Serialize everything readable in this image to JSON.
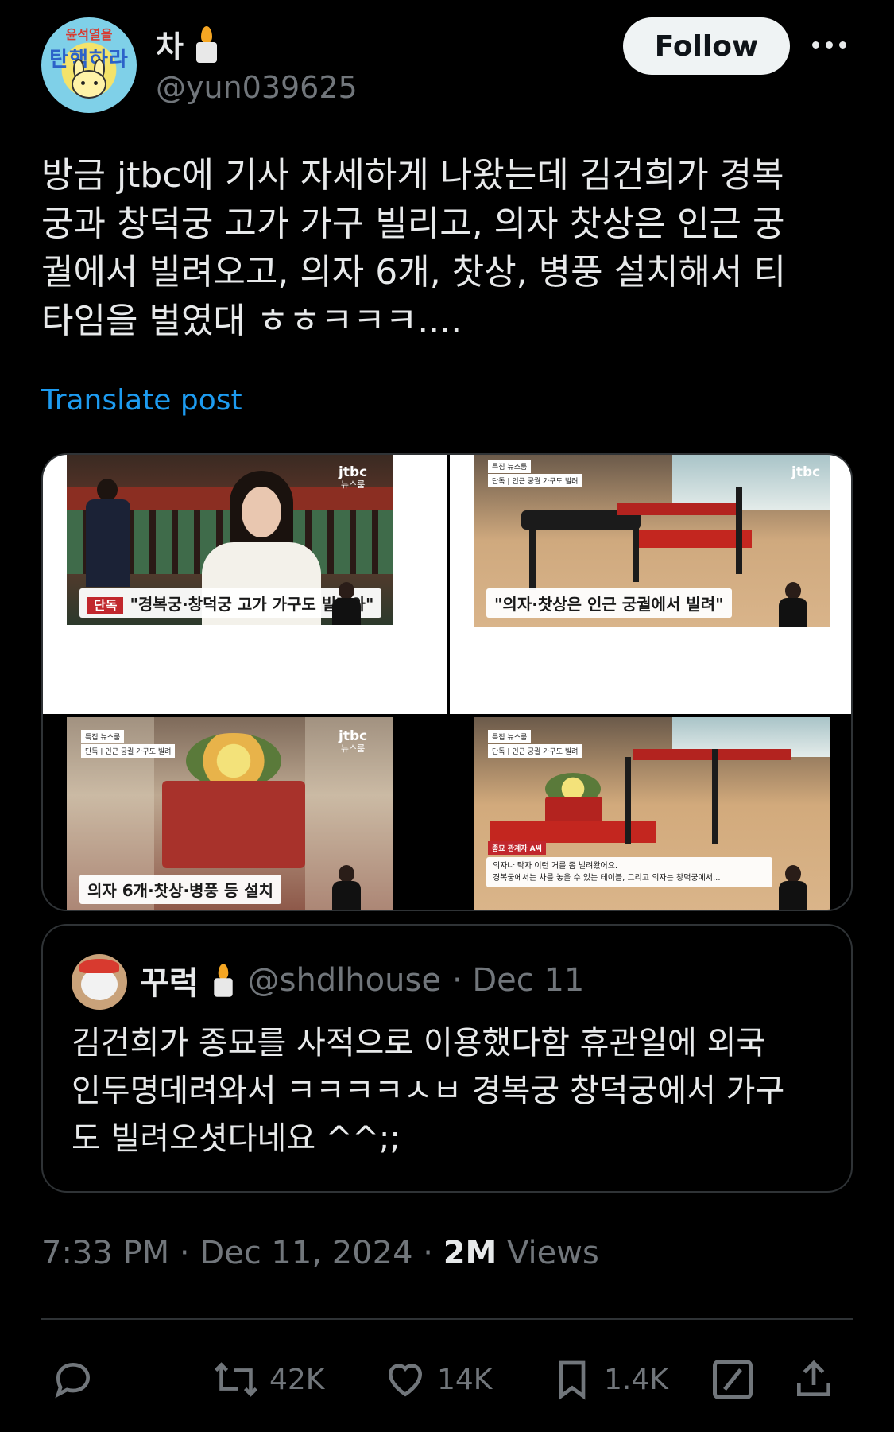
{
  "author": {
    "display_name": "차",
    "handle": "@yun039625",
    "avatar_text_top": "윤석열을",
    "avatar_text_main": "탄핵하라"
  },
  "follow_label": "Follow",
  "tweet": {
    "text": "방금 jtbc에 기사 자세하게 나왔는데 김건희가 경복\n궁과 창덕궁 고가 가구 빌리고, 의자 찻상은 인근 궁\n궐에서 빌려오고, 의자 6개, 찻상, 병풍 설치해서 티\n타임을 벌였대 ㅎㅎㅋㅋㅋ....",
    "translate_label": "Translate post"
  },
  "media": {
    "frame1": {
      "tag": "단독",
      "caption": "\"경복궁·창덕궁 고가 가구도 빌려와\"",
      "logo": "jtbc",
      "logo_sub": "뉴스룸"
    },
    "frame2": {
      "caption": "\"의자·찻상은 인근 궁궐에서 빌려\"",
      "label": "특집 뉴스룸",
      "sub_label": "단독 | 인근 궁궐 가구도 빌려",
      "logo": "jtbc"
    },
    "frame3": {
      "caption": "의자 6개·찻상·병풍 등 설치",
      "label": "특집 뉴스룸",
      "sub_label": "단독 | 인근 궁궐 가구도 빌려",
      "logo": "jtbc",
      "logo_sub": "뉴스룸"
    },
    "frame4": {
      "speaker": "종묘 관계자 A씨",
      "line1": "의자나 탁자 이런 거를 좀 빌려왔어요.",
      "line2": "경복궁에서는 차를 놓을 수 있는 테이블, 그리고 의자는 창덕궁에서...",
      "label": "특집 뉴스룸",
      "sub_label": "단독 | 인근 궁궐 가구도 빌려"
    }
  },
  "quote": {
    "name": "꾸럭",
    "handle": "@shdlhouse",
    "date": "· Dec 11",
    "text": "김건희가 종묘를 사적으로 이용했다함 휴관일에 외국\n인두명데려와서 ㅋㅋㅋㅋㅅㅂ 경복궁 창덕궁에서 가구\n도 빌려오셧다네요 ^^;;"
  },
  "timestamp": {
    "time": "7:33 PM · Dec 11, 2024 · ",
    "views_count": "2M",
    "views_label": " Views"
  },
  "actions": {
    "reposts": "42K",
    "likes": "14K",
    "bookmarks": "1.4K"
  },
  "colors": {
    "link": "#1d9bf0",
    "muted": "#71767b",
    "text": "#e7e9ea",
    "border": "#2f3336"
  }
}
